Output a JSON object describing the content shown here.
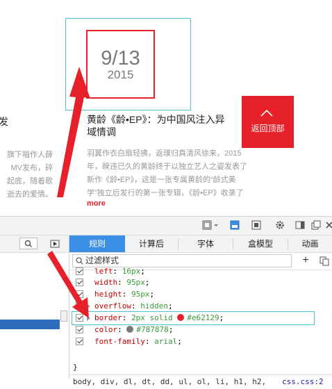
{
  "page": {
    "date_day": "9/13",
    "date_year": "2015",
    "left_title": "发",
    "left_lines": [
      "旗下唱作人薛",
      "MV发布，碎",
      "起底，随着歌",
      "逝去的爱情。"
    ],
    "article_title": "黄龄《龄•EP》：为中国风注入异域情调",
    "article_lines": [
      "羽翼作衣白扇轻拂，返璞归真清风徐来，2015",
      "年，睽违已久的黄龄终于以独立艺人之姿发表了",
      "新作《龄•EP》，这是一张专属黄龄的“龄式美",
      "学”独立后发行的第一张专辑，《龄•EP》收录了"
    ],
    "more_label": "more",
    "back_top_label": "返回顶部"
  },
  "devtools": {
    "tabs": [
      "规则",
      "计算后",
      "字体",
      "盒模型",
      "动画"
    ],
    "active_tab": "规则",
    "filter_placeholder": "过滤样式",
    "plus_label": "+",
    "rules": [
      {
        "name": "left",
        "value": "16px",
        "expander": false
      },
      {
        "name": "width",
        "value": "95px",
        "expander": false
      },
      {
        "name": "height",
        "value": "95px",
        "expander": false
      },
      {
        "name": "overflow",
        "value": "hidden",
        "expander": true
      },
      {
        "name": "border",
        "value": "2px solid",
        "color_value": "#e62129",
        "swatch": "#e62129",
        "expander": true,
        "highlight": true
      },
      {
        "name": "color",
        "value": "#787878",
        "swatch": "#787878",
        "expander": false
      },
      {
        "name": "font-family",
        "value": "arial",
        "expander": false
      }
    ],
    "closing_brace": "}",
    "selector_text": "body, div, dl, dt, dd, ul, ol, li, h1, h2,",
    "selector_link": "css.css:2"
  },
  "colors": {
    "accent_red": "#e62129",
    "highlight_cyan": "#4fc3d4",
    "tab_blue": "#3a8ee6",
    "date_gray": "#787878"
  }
}
